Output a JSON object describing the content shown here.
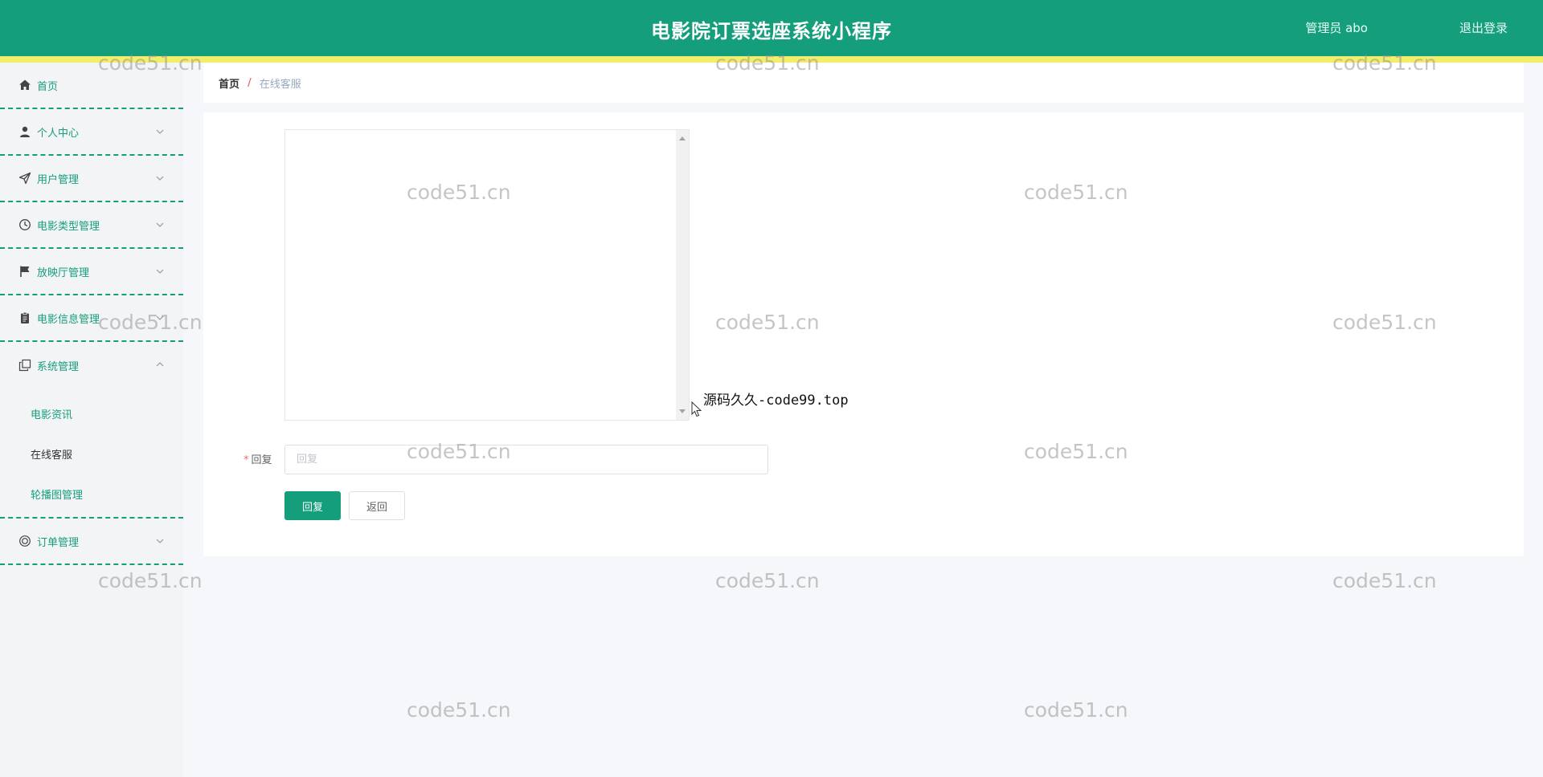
{
  "header": {
    "title": "电影院订票选座系统小程序",
    "user": "管理员 abo",
    "logout": "退出登录",
    "colors": {
      "primary": "#149e7c",
      "stripe": "#f2ee6a"
    }
  },
  "sidebar": {
    "items": [
      {
        "label": "首页",
        "icon": "home-icon",
        "has_chevron": false
      },
      {
        "label": "个人中心",
        "icon": "user-icon",
        "has_chevron": true
      },
      {
        "label": "用户管理",
        "icon": "send-icon",
        "has_chevron": true
      },
      {
        "label": "电影类型管理",
        "icon": "clock-icon",
        "has_chevron": true
      },
      {
        "label": "放映厅管理",
        "icon": "flag-icon",
        "has_chevron": true
      },
      {
        "label": "电影信息管理",
        "icon": "clipboard-icon",
        "has_chevron": true
      },
      {
        "label": "系统管理",
        "icon": "copy-icon",
        "has_chevron": true,
        "expanded": true
      },
      {
        "label": "订单管理",
        "icon": "target-icon",
        "has_chevron": true
      }
    ],
    "system_submenu": [
      {
        "label": "电影资讯",
        "active": false
      },
      {
        "label": "在线客服",
        "active": true
      },
      {
        "label": "轮播图管理",
        "active": false
      }
    ]
  },
  "breadcrumb": {
    "home": "首页",
    "separator": "/",
    "current": "在线客服"
  },
  "form": {
    "reply_label": "回复",
    "required_mark": "*",
    "reply_placeholder": "回复",
    "reply_button": "回复",
    "back_button": "返回"
  },
  "overlay": {
    "source_tag": "源码久久-code99.top"
  },
  "watermark": "code51.cn"
}
